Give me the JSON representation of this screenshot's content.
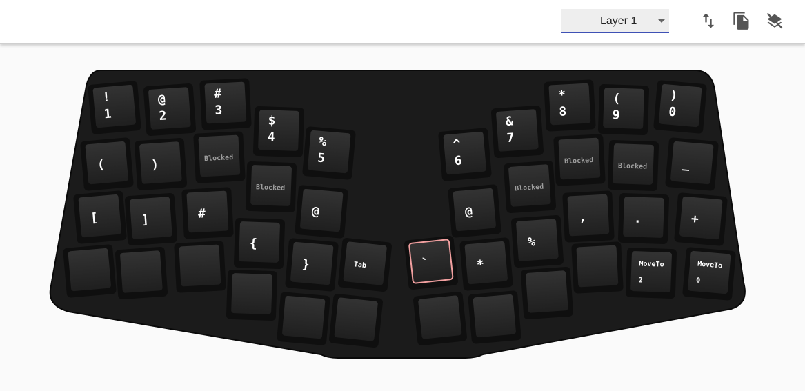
{
  "toolbar": {
    "layer_selected": "Layer 1",
    "icons": [
      "swap-vertical-icon",
      "copy-icon",
      "layers-off-icon"
    ]
  },
  "keyboard": {
    "keys": [
      {
        "id": "k-l0-0",
        "legend": [
          "!",
          "1"
        ]
      },
      {
        "id": "k-l0-1",
        "legend": [
          "@",
          "2"
        ]
      },
      {
        "id": "k-l0-2",
        "legend": [
          "#",
          "3"
        ]
      },
      {
        "id": "k-l0-3",
        "legend": [
          "$",
          "4"
        ]
      },
      {
        "id": "k-l0-4",
        "legend": [
          "%",
          "5"
        ]
      },
      {
        "id": "k-l1-0",
        "legend": [
          "("
        ]
      },
      {
        "id": "k-l1-1",
        "legend": [
          ")"
        ]
      },
      {
        "id": "k-l1-2",
        "legend": [
          "Blocked"
        ],
        "blocked": true
      },
      {
        "id": "k-l1-3",
        "legend": [
          "Blocked"
        ],
        "blocked": true
      },
      {
        "id": "k-l1-4",
        "legend": [
          "@"
        ]
      },
      {
        "id": "k-l2-0",
        "legend": [
          "["
        ]
      },
      {
        "id": "k-l2-1",
        "legend": [
          "]"
        ]
      },
      {
        "id": "k-l2-2",
        "legend": [
          "#"
        ]
      },
      {
        "id": "k-l2-3",
        "legend": [
          "{"
        ]
      },
      {
        "id": "k-l2-4",
        "legend": [
          "}"
        ]
      },
      {
        "id": "k-l2-5",
        "legend": [
          "Tab"
        ],
        "small": true
      },
      {
        "id": "k-l3-0",
        "legend": []
      },
      {
        "id": "k-l3-1",
        "legend": []
      },
      {
        "id": "k-l3-2",
        "legend": []
      },
      {
        "id": "k-l3-3",
        "legend": []
      },
      {
        "id": "k-l3-4",
        "legend": []
      },
      {
        "id": "k-l3-5",
        "legend": []
      },
      {
        "id": "k-r0-0",
        "legend": [
          "^",
          "6"
        ]
      },
      {
        "id": "k-r0-1",
        "legend": [
          "&",
          "7"
        ]
      },
      {
        "id": "k-r0-2",
        "legend": [
          "*",
          "8"
        ]
      },
      {
        "id": "k-r0-3",
        "legend": [
          "(",
          "9"
        ]
      },
      {
        "id": "k-r0-4",
        "legend": [
          ")",
          "0"
        ]
      },
      {
        "id": "k-r1-0",
        "legend": [
          "@"
        ]
      },
      {
        "id": "k-r1-1",
        "legend": [
          "Blocked"
        ],
        "blocked": true
      },
      {
        "id": "k-r1-2",
        "legend": [
          "Blocked"
        ],
        "blocked": true
      },
      {
        "id": "k-r1-3",
        "legend": [
          "Blocked"
        ],
        "blocked": true
      },
      {
        "id": "k-r1-4",
        "legend": [
          "_"
        ]
      },
      {
        "id": "k-r2-0",
        "legend": [
          "`"
        ],
        "selected": true
      },
      {
        "id": "k-r2-1",
        "legend": [
          "*"
        ]
      },
      {
        "id": "k-r2-2",
        "legend": [
          "%"
        ]
      },
      {
        "id": "k-r2-3",
        "legend": [
          ","
        ]
      },
      {
        "id": "k-r2-4",
        "legend": [
          "."
        ]
      },
      {
        "id": "k-r2-5",
        "legend": [
          "+"
        ]
      },
      {
        "id": "k-r3-0",
        "legend": []
      },
      {
        "id": "k-r3-1",
        "legend": []
      },
      {
        "id": "k-r3-2",
        "legend": []
      },
      {
        "id": "k-r3-3",
        "legend": []
      },
      {
        "id": "k-r3-4",
        "legend": [
          "MoveTo",
          "2"
        ],
        "small": true
      },
      {
        "id": "k-r3-5",
        "legend": [
          "MoveTo",
          "0"
        ],
        "small": true
      }
    ]
  },
  "colors": {
    "accent": "#3f51b5",
    "board": "#1b1b1b",
    "key": "#272727",
    "selected_outline": "#f2a0a0"
  }
}
